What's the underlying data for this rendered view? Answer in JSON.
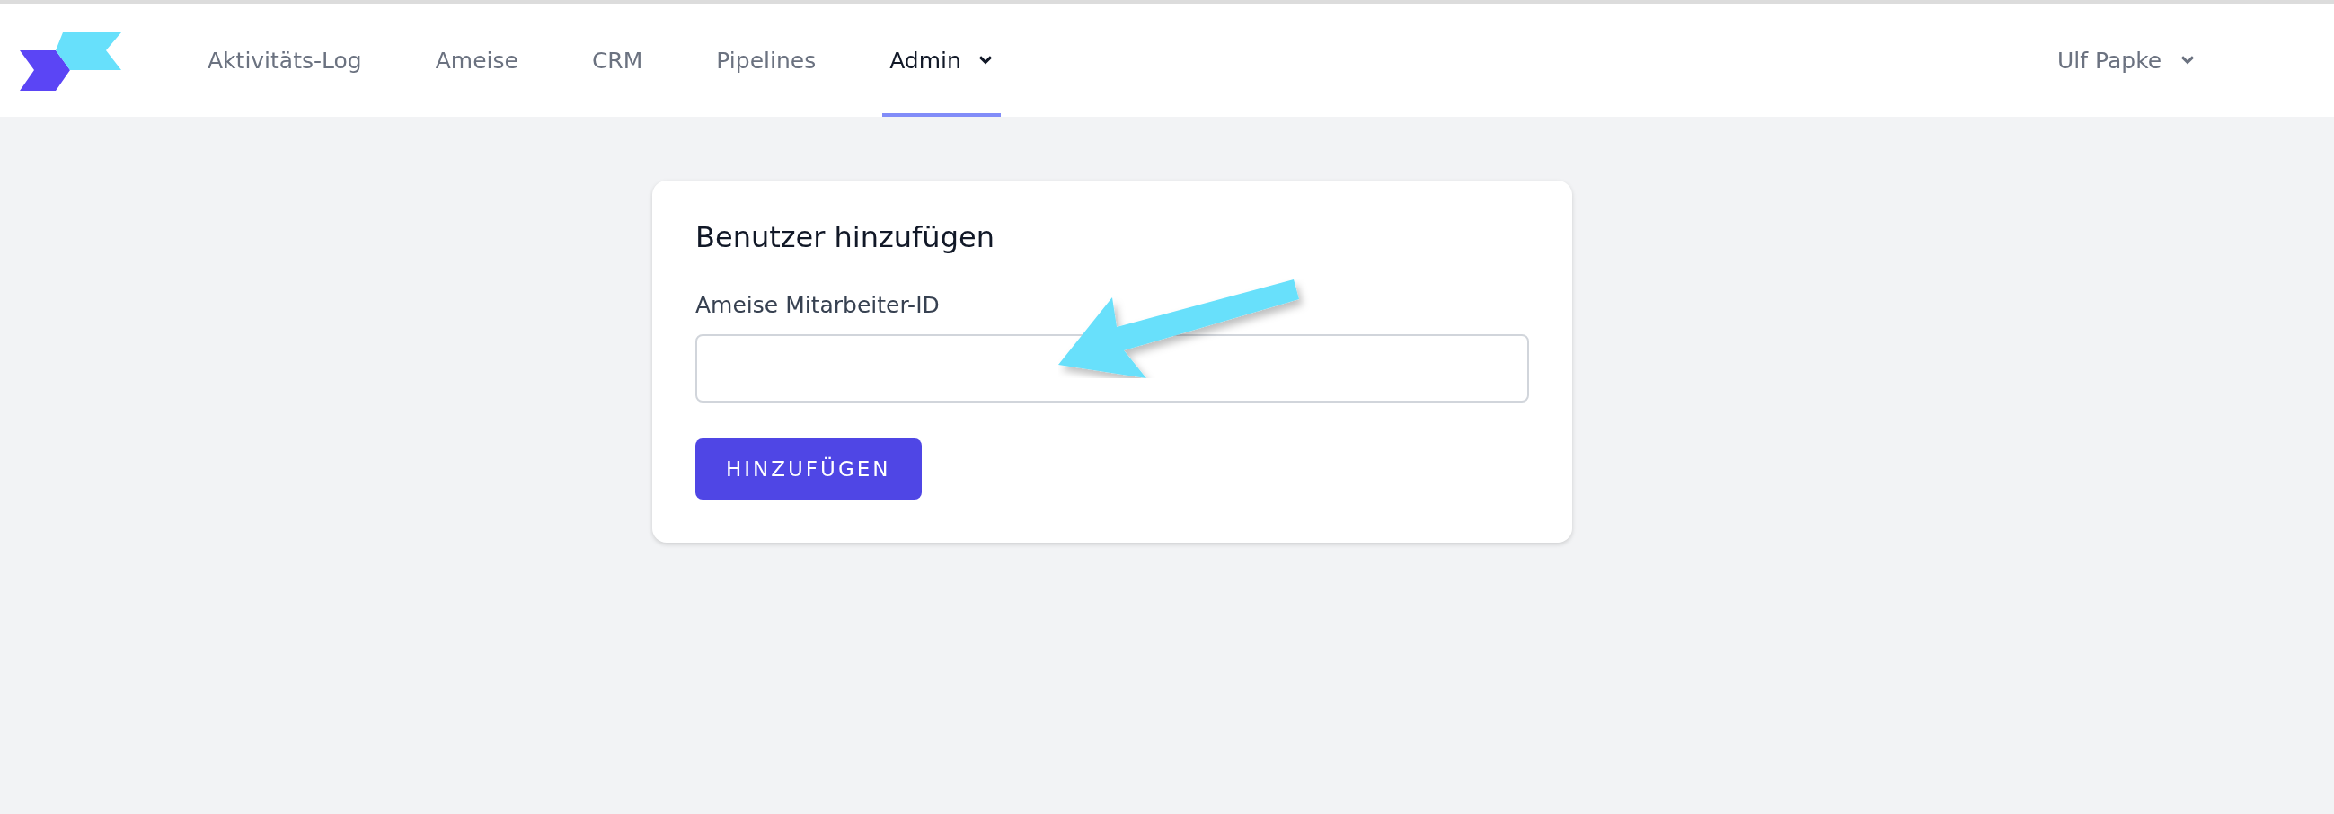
{
  "nav": {
    "items": [
      {
        "label": "Aktivitäts-Log",
        "selected": false,
        "dropdown": false
      },
      {
        "label": "Ameise",
        "selected": false,
        "dropdown": false
      },
      {
        "label": "CRM",
        "selected": false,
        "dropdown": false
      },
      {
        "label": "Pipelines",
        "selected": false,
        "dropdown": false
      },
      {
        "label": "Admin",
        "selected": true,
        "dropdown": true
      }
    ],
    "user": {
      "name": "Ulf Papke",
      "dropdown": true
    }
  },
  "card": {
    "title": "Benutzer hinzufügen",
    "field": {
      "label": "Ameise Mitarbeiter-ID"
    },
    "button": "HINZUFÜGEN"
  }
}
